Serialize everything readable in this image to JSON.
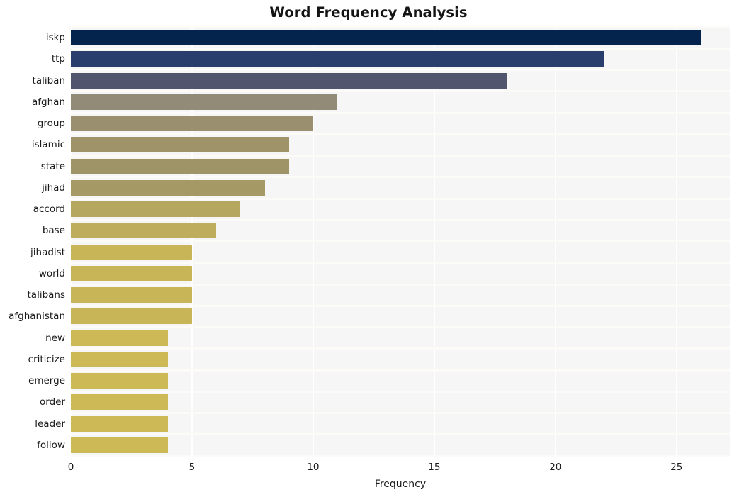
{
  "chart_data": {
    "type": "bar",
    "orientation": "horizontal",
    "title": "Word Frequency Analysis",
    "xlabel": "Frequency",
    "ylabel": "",
    "categories": [
      "iskp",
      "ttp",
      "taliban",
      "afghan",
      "group",
      "islamic",
      "state",
      "jihad",
      "accord",
      "base",
      "jihadist",
      "world",
      "talibans",
      "afghanistan",
      "new",
      "criticize",
      "emerge",
      "order",
      "leader",
      "follow"
    ],
    "values": [
      26,
      22,
      18,
      11,
      10,
      9,
      9,
      8,
      7,
      6,
      5,
      5,
      5,
      5,
      4,
      4,
      4,
      4,
      4,
      4
    ],
    "xlim": [
      0,
      27.2
    ],
    "xticks": [
      0,
      5,
      10,
      15,
      20,
      25
    ],
    "xtick_labels": [
      "0",
      "5",
      "10",
      "15",
      "20",
      "25"
    ],
    "grid": true,
    "grid_axis": "x",
    "legend": false,
    "bar_colors": [
      "#04234d",
      "#2a3e6e",
      "#51556e",
      "#918b78",
      "#9a9070",
      "#9f9469",
      "#9f9468",
      "#a59a65",
      "#b5a75f",
      "#bdad5c",
      "#c8b557",
      "#c8b557",
      "#c8b557",
      "#c8b557",
      "#cdb955",
      "#cdb955",
      "#cdb955",
      "#cdb955",
      "#cdb955",
      "#cdb955"
    ]
  },
  "style": {
    "plot_background": "#f6f6f7",
    "figure_background": "#ffffff",
    "grid_color": "#ffffff",
    "text_color": "#1a1a1a",
    "title_color": "#141414"
  }
}
